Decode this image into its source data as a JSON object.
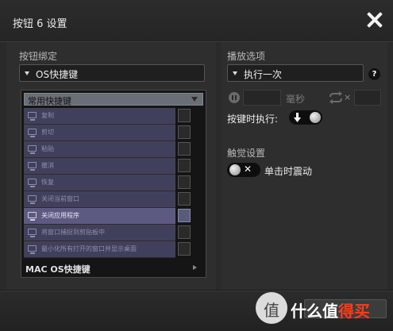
{
  "dialog": {
    "title": "按钮 6 设置",
    "close_icon": "close-icon"
  },
  "left": {
    "binding_label": "按钮绑定",
    "binding_value": "OS快捷键",
    "category_header": "常用快捷键",
    "items": [
      {
        "label": "复制",
        "selected": false
      },
      {
        "label": "剪切",
        "selected": false
      },
      {
        "label": "粘贴",
        "selected": false
      },
      {
        "label": "撤消",
        "selected": false
      },
      {
        "label": "恢复",
        "selected": false
      },
      {
        "label": "关闭当前窗口",
        "selected": false
      },
      {
        "label": "关闭应用程序",
        "selected": true
      },
      {
        "label": "将窗口捕捉到剪贴板中",
        "selected": false
      },
      {
        "label": "最小化所有打开的窗口并显示桌面",
        "selected": false
      }
    ],
    "footer_category": "MAC OS快捷键"
  },
  "right": {
    "playback_label": "播放选项",
    "playback_value": "执行一次",
    "ms_unit": "毫秒",
    "times_glyph": "×",
    "while_pressed_label": "按键时执行:",
    "haptic_label": "触觉设置",
    "vibrate_label": "单击时震动"
  },
  "watermark": {
    "logo": "值",
    "text_white": "什么值",
    "text_red": "得买"
  },
  "colors": {
    "selected_row": "#5d5a82",
    "row": "#41405c",
    "watermark_red": "#ff3b1f"
  }
}
